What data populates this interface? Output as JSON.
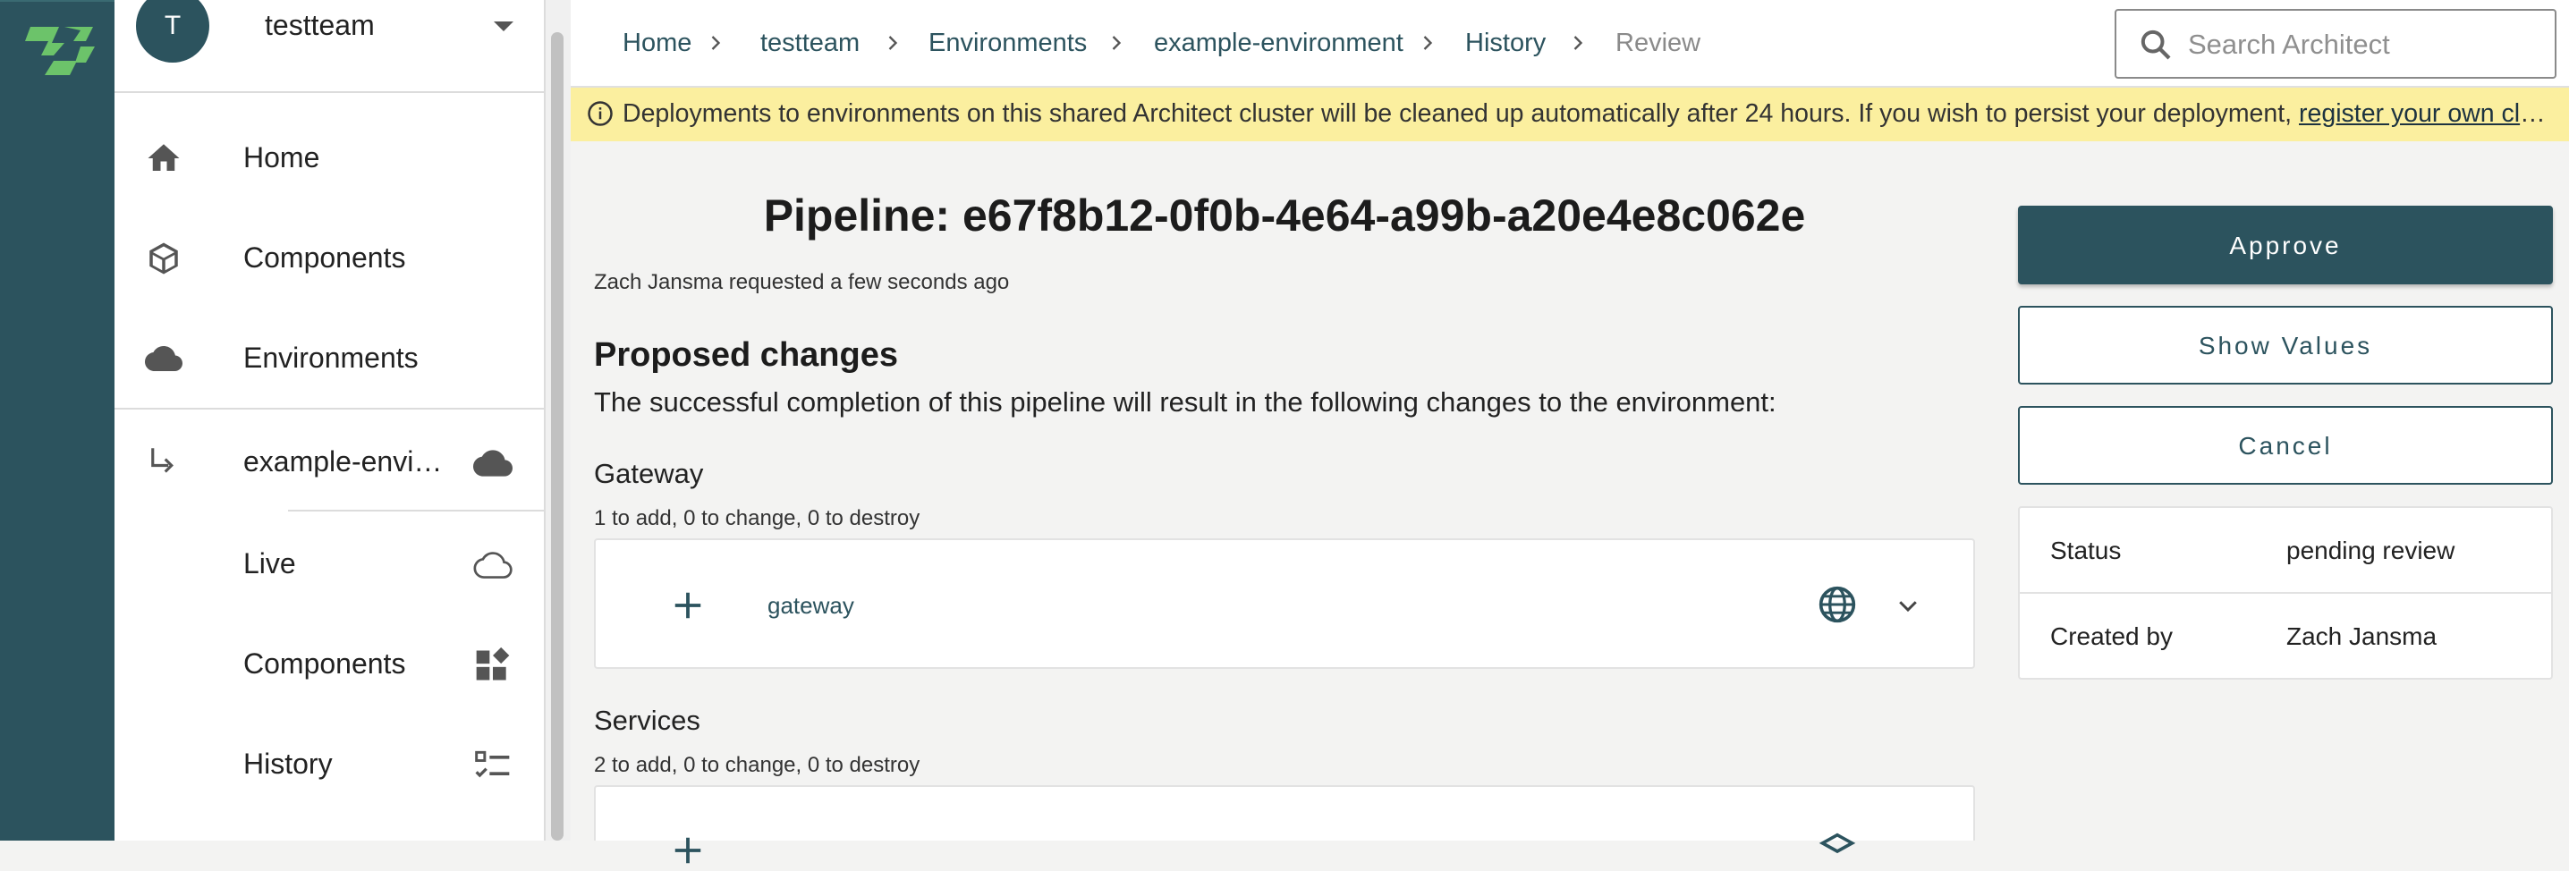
{
  "team": {
    "avatar_letter": "T",
    "name": "testteam"
  },
  "sidebar": {
    "items": [
      {
        "label": "Home",
        "icon": "home-icon"
      },
      {
        "label": "Components",
        "icon": "cube-icon"
      },
      {
        "label": "Environments",
        "icon": "cloud-icon"
      }
    ],
    "environment": {
      "label": "example-envi…",
      "icon": "cloud-filled-icon"
    },
    "sub_items": [
      {
        "label": "Live",
        "icon": "cloud-outline-icon"
      },
      {
        "label": "Components",
        "icon": "widgets-icon"
      },
      {
        "label": "History",
        "icon": "checklist-icon"
      }
    ]
  },
  "breadcrumb": [
    "Home",
    "testteam",
    "Environments",
    "example-environment",
    "History",
    "Review"
  ],
  "search": {
    "placeholder": "Search Architect"
  },
  "banner": {
    "text": "Deployments to environments on this shared Architect cluster will be cleaned up automatically after 24 hours. If you wish to persist your deployment, ",
    "link": "register your own cluster"
  },
  "pipeline": {
    "title": "Pipeline: e67f8b12-0f0b-4e64-a99b-a20e4e8c062e",
    "requested": "Zach Jansma requested a few seconds ago",
    "proposed_heading": "Proposed changes",
    "proposed_text": "The successful completion of this pipeline will result in the following changes to the environment:",
    "sections": [
      {
        "title": "Gateway",
        "summary": "1 to add, 0 to change, 0 to destroy",
        "resource": "gateway"
      },
      {
        "title": "Services",
        "summary": "2 to add, 0 to change, 0 to destroy",
        "resource": ""
      }
    ]
  },
  "actions": {
    "approve": "Approve",
    "show_values": "Show Values",
    "cancel": "Cancel"
  },
  "details": {
    "status_label": "Status",
    "status_value": "pending review",
    "created_label": "Created by",
    "created_value": "Zach Jansma"
  },
  "colors": {
    "brand": "#2c535e",
    "banner": "#fbef9f",
    "logo": "#6cc36a"
  }
}
